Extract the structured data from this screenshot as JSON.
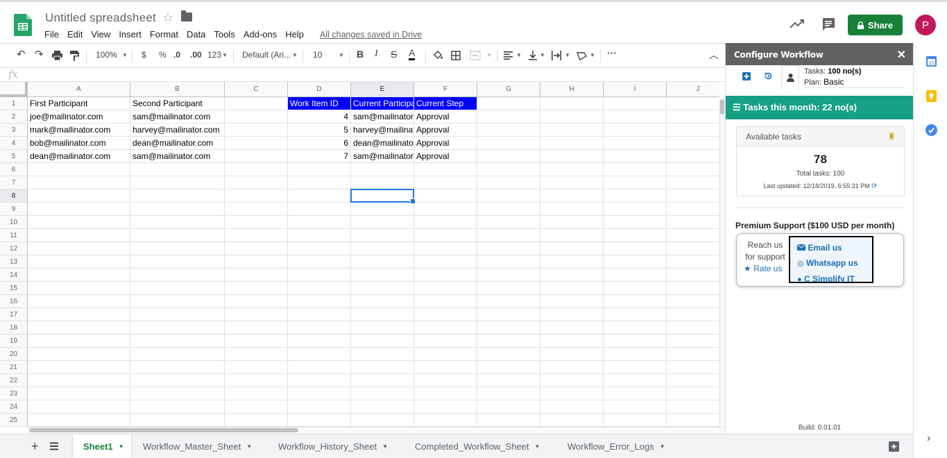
{
  "doc": {
    "title": "Untitled spreadsheet",
    "saved_status": "All changes saved in Drive"
  },
  "menu": [
    "File",
    "Edit",
    "View",
    "Insert",
    "Format",
    "Data",
    "Tools",
    "Add-ons",
    "Help"
  ],
  "header": {
    "share_label": "Share",
    "avatar_letter": "P"
  },
  "toolbar": {
    "zoom": "100%",
    "currency": "$",
    "percent": "%",
    "dec_less": ".0",
    "dec_more": ".00",
    "format": "123",
    "font": "Default (Ari...",
    "size": "10"
  },
  "formula": {
    "fx": "fx"
  },
  "columns": [
    "A",
    "B",
    "C",
    "D",
    "E",
    "F",
    "G",
    "H",
    "I",
    "J"
  ],
  "rows": [
    "1",
    "2",
    "3",
    "4",
    "5",
    "6",
    "7",
    "8",
    "9",
    "10",
    "11",
    "12",
    "13",
    "14",
    "15",
    "16",
    "17",
    "18",
    "19",
    "20",
    "21",
    "22",
    "23",
    "24",
    "25"
  ],
  "cells": {
    "A1": "First Participant",
    "B1": "Second Participant",
    "D1": "Work Item ID",
    "E1": "Current Participa",
    "F1": "Current Step",
    "A2": "joe@mailinator.com",
    "B2": "sam@mailinator.com",
    "D2": "4",
    "E2": "sam@mailinator.",
    "F2": "Approval",
    "A3": "mark@mailinator.com",
    "B3": "harvey@mailinator.com",
    "D3": "5",
    "E3": "harvey@mailinat",
    "F3": "Approval",
    "A4": "bob@mailinator.com",
    "B4": "dean@mailinator.com",
    "D4": "6",
    "E4": "dean@mailinator",
    "F4": "Approval",
    "A5": "dean@mailinator.com",
    "B5": "sam@mailinator.com",
    "D5": "7",
    "E5": "sam@mailinator.",
    "F5": "Approval"
  },
  "sheet_tabs": [
    "Sheet1",
    "Workflow_Master_Sheet",
    "Workflow_History_Sheet",
    "Completed_Workflow_Sheet",
    "Workflow_Error_Logs"
  ],
  "panel": {
    "title": "Configure Workflow",
    "tasks_label": "Tasks:",
    "tasks_value": "100 no(s)",
    "plan_label": "Plan:",
    "plan_value": "Basic",
    "month_bar": "Tasks this month: 22 no(s)",
    "available_label": "Available tasks",
    "available_count": "78",
    "total_tasks": "Total tasks: 100",
    "last_updated": "Last updated: 12/18/2019, 6:55:31 PM",
    "premium": "Premium Support ($100 USD per month)",
    "reach_line1": "Reach us",
    "reach_line2": "for support",
    "rate": "Rate us",
    "email": "Email us",
    "whatsapp": "Whatsapp us",
    "simplify": "C Simplify IT",
    "build": "Build: 0.01.01"
  },
  "colors": {
    "accent_green": "#188038",
    "panel_green": "#16a085",
    "header_fill": "#0000ff",
    "selection": "#1a73e8"
  }
}
